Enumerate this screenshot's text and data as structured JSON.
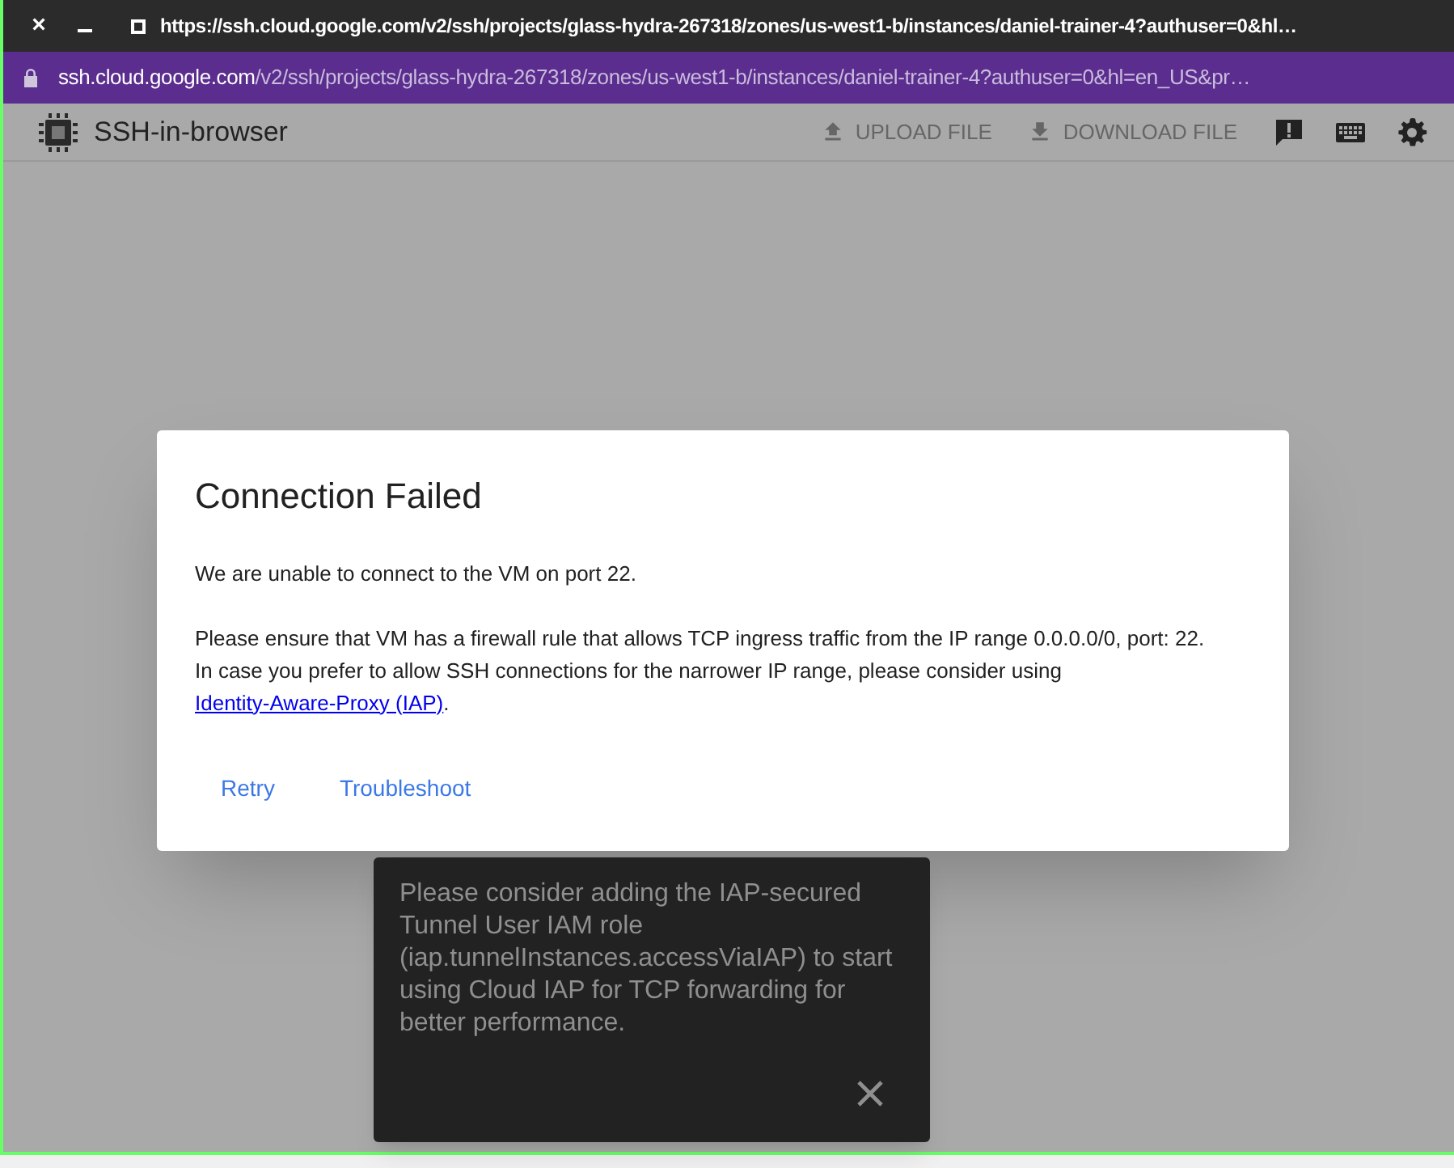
{
  "window": {
    "close_glyph": "×",
    "title": "https://ssh.cloud.google.com/v2/ssh/projects/glass-hydra-267318/zones/us-west1-b/instances/daniel-trainer-4?authuser=0&hl…"
  },
  "address_bar": {
    "domain": "ssh.cloud.google.com",
    "path": "/v2/ssh/projects/glass-hydra-267318/zones/us-west1-b/instances/daniel-trainer-4?authuser=0&hl=en_US&pr…"
  },
  "toolbar": {
    "app_name": "SSH-in-browser",
    "actions": [
      {
        "kind": "upload",
        "label": "UPLOAD FILE",
        "disabled": true
      },
      {
        "kind": "download",
        "label": "DOWNLOAD FILE",
        "disabled": true
      },
      {
        "kind": "feedback"
      },
      {
        "kind": "keyboard"
      },
      {
        "kind": "settings"
      }
    ]
  },
  "dialog": {
    "title": "Connection Failed",
    "message": "We are unable to connect to the VM on port 22.",
    "detail": {
      "text": "Please ensure that VM has a firewall rule that allows TCP ingress traffic from the IP range 0.0.0.0/0, port: 22. In case you prefer to allow SSH connections for the narrower IP range, please consider using",
      "link": "Identity-Aware-Proxy (IAP)",
      "after": "."
    },
    "buttons": [
      "Retry",
      "Troubleshoot"
    ]
  },
  "snackbar": {
    "message": "Please consider adding the IAP-secured Tunnel User IAM role (iap.tunnelInstances.accessViaIAP) to start using Cloud IAP for TCP forwarding for better performance."
  }
}
